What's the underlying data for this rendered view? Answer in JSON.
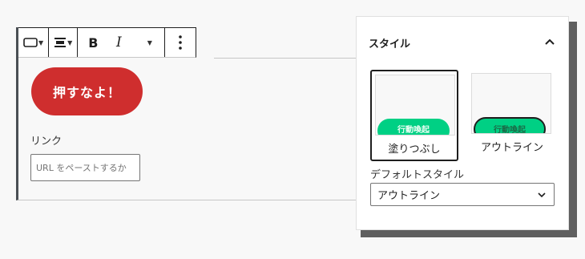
{
  "toolbar": {
    "tools": [
      {
        "name": "block-type",
        "icon": "button-rect-icon",
        "has_dropdown": true
      },
      {
        "name": "align",
        "icon": "align-center-icon",
        "has_dropdown": true
      },
      {
        "name": "bold",
        "label": "B"
      },
      {
        "name": "italic",
        "label": "I"
      },
      {
        "name": "more-rich-text",
        "has_dropdown": true
      },
      {
        "name": "options",
        "icon": "vertical-ellipsis-icon"
      }
    ]
  },
  "button_block": {
    "text": "押すなよ！",
    "background": "#cf2e2e",
    "text_color": "#ffffff"
  },
  "link": {
    "label": "リンク",
    "placeholder": "URL をペーストするか"
  },
  "style_panel": {
    "title": "スタイル",
    "expanded": true,
    "options": [
      {
        "label": "塗りつぶし",
        "preview_text": "行動喚起",
        "selected": true
      },
      {
        "label": "アウトライン",
        "preview_text": "行動喚起",
        "selected": false
      }
    ],
    "default_style_label": "デフォルトスタイル",
    "default_style_value": "アウトライン",
    "preview_color": "#00d084"
  }
}
